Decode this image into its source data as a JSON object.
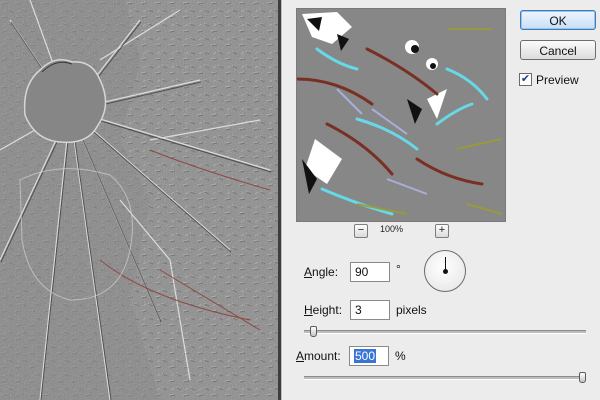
{
  "dialog": {
    "ok_label": "OK",
    "cancel_label": "Cancel",
    "preview_label": "Preview",
    "preview_checked": true,
    "zoom": {
      "level": "100%"
    },
    "angle": {
      "label": "Angle",
      "value": "90",
      "unit": "°"
    },
    "height": {
      "label": "Height",
      "value": "3",
      "unit": "pixels",
      "slider_fraction": 0.02
    },
    "amount": {
      "label": "Amount",
      "value": "500",
      "unit": "%",
      "slider_fraction": 1.0
    }
  },
  "colors": {
    "dialog_bg": "#ececec",
    "emboss_gray": "#8a8a8a",
    "selection": "#3875d7",
    "ok_focus": "#3d7bbd"
  },
  "icons": {
    "zoom_out": "minus-icon",
    "zoom_in": "plus-icon",
    "checkbox": "checkmark-icon"
  }
}
